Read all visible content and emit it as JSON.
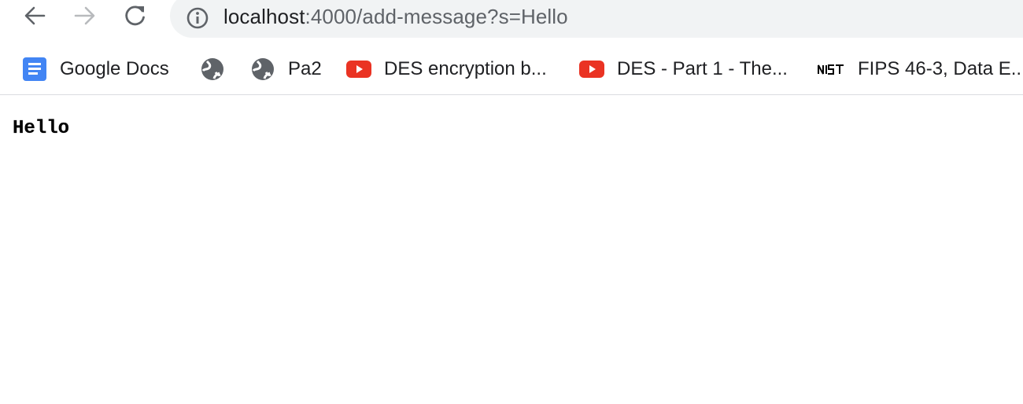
{
  "toolbar": {
    "back_icon": "arrow-left-icon",
    "forward_icon": "arrow-right-icon",
    "reload_icon": "reload-icon",
    "info_icon": "info-icon"
  },
  "omnibox": {
    "host": "localhost",
    "path": ":4000/add-message?s=Hello"
  },
  "bookmarks": [
    {
      "label": "Google Docs",
      "icon": "google-docs-icon"
    },
    {
      "label": "",
      "icon": "globe-icon"
    },
    {
      "label": "Pa2",
      "icon": "globe-icon"
    },
    {
      "label": "DES encryption b...",
      "icon": "youtube-icon"
    },
    {
      "label": "DES - Part 1 - The...",
      "icon": "youtube-icon"
    },
    {
      "label": "FIPS 46-3, Data E...",
      "icon": "nist-icon"
    }
  ],
  "page": {
    "body_text": "Hello"
  },
  "colors": {
    "omnibox_bg": "#f1f3f4",
    "youtube_red": "#ea3323",
    "docs_blue": "#4285f4",
    "text": "#202124",
    "muted": "#5f6368"
  }
}
